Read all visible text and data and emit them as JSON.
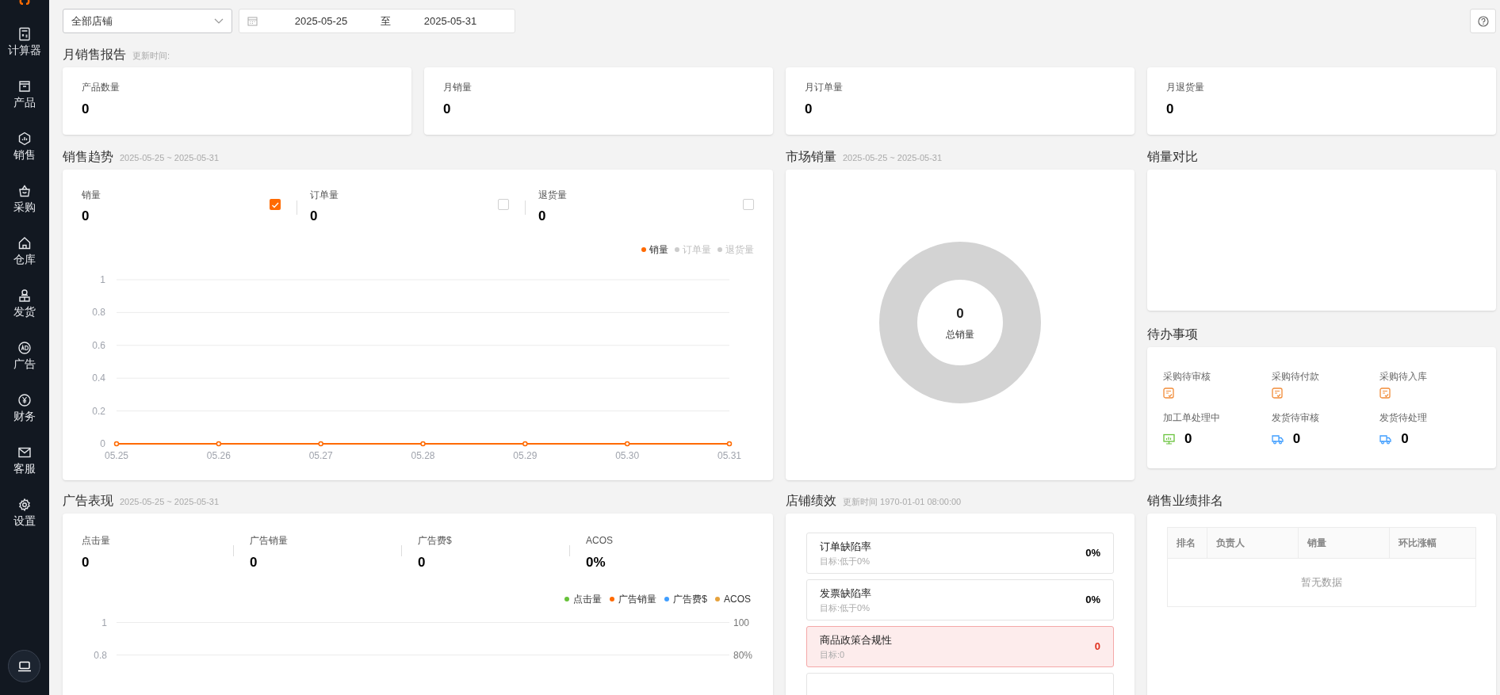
{
  "sidebar": {
    "items": [
      {
        "label": "计算器",
        "kind": "calculator"
      },
      {
        "label": "产品",
        "kind": "box"
      },
      {
        "label": "销售",
        "kind": "chart"
      },
      {
        "label": "采购",
        "kind": "basket"
      },
      {
        "label": "仓库",
        "kind": "home"
      },
      {
        "label": "发货",
        "kind": "courier"
      },
      {
        "label": "广告",
        "kind": "ad"
      },
      {
        "label": "财务",
        "kind": "yen"
      },
      {
        "label": "客服",
        "kind": "mail"
      },
      {
        "label": "设置",
        "kind": "gear"
      }
    ]
  },
  "toolbar": {
    "store_select": {
      "value": "全部店铺"
    },
    "date_range": {
      "start": "2025-05-25",
      "separator": "至",
      "end": "2025-05-31"
    }
  },
  "monthly_report": {
    "title": "月销售报告",
    "subtitle": "更新时间:",
    "cards": [
      {
        "label": "产品数量",
        "value": "0"
      },
      {
        "label": "月销量",
        "value": "0"
      },
      {
        "label": "月订单量",
        "value": "0"
      },
      {
        "label": "月退货量",
        "value": "0"
      }
    ]
  },
  "sales_trend": {
    "title": "销售趋势",
    "subtitle": "2025-05-25 ~ 2025-05-31",
    "metrics": [
      {
        "label": "销量",
        "value": "0",
        "checked": true
      },
      {
        "label": "订单量",
        "value": "0",
        "checked": false
      },
      {
        "label": "退货量",
        "value": "0",
        "checked": false
      }
    ],
    "legend": [
      {
        "label": "订单量",
        "active": false
      },
      {
        "label": "退货量",
        "active": false
      }
    ],
    "chart_data": {
      "type": "line",
      "categories": [
        "05.25",
        "05.26",
        "05.27",
        "05.28",
        "05.29",
        "05.30",
        "05.31"
      ],
      "series": [
        {
          "name": "销量",
          "color": "#ff6a00",
          "marker": true,
          "values": [
            0,
            0,
            0,
            0,
            0,
            0,
            0
          ]
        }
      ],
      "ylim": [
        0,
        1
      ],
      "yticks": [
        0,
        0.2,
        0.4,
        0.6,
        0.8,
        1
      ],
      "grid": true
    }
  },
  "market_sales": {
    "title": "市场销量",
    "subtitle": "2025-05-25 ~ 2025-05-31",
    "total": "0",
    "total_label": "总销量"
  },
  "sales_comparison": {
    "title": "销量对比"
  },
  "todo": {
    "title": "待办事项",
    "items": [
      {
        "label": "采购待审核",
        "kind": "doc"
      },
      {
        "label": "采购待付款",
        "kind": "doc"
      },
      {
        "label": "采购待入库",
        "kind": "doc"
      },
      {
        "label": "加工单处理中",
        "kind": "monitor",
        "count": "0"
      },
      {
        "label": "发货待审核",
        "kind": "truck",
        "count": "0"
      },
      {
        "label": "发货待处理",
        "kind": "truck",
        "count": "0"
      }
    ]
  },
  "ad_performance": {
    "title": "广告表现",
    "subtitle": "2025-05-25 ~ 2025-05-31",
    "metrics": [
      {
        "label": "点击量",
        "value": "0"
      },
      {
        "label": "广告销量",
        "value": "0"
      },
      {
        "label": "广告费$",
        "value": "0"
      },
      {
        "label": "ACOS",
        "value": "0%"
      }
    ],
    "legend": [
      {
        "label": "点击量",
        "color": "#67c23a"
      },
      {
        "label": "广告销量",
        "color": "#ff6a00"
      },
      {
        "label": "广告费$",
        "color": "#409eff"
      },
      {
        "label": "ACOS",
        "color": "#e6a23c"
      }
    ],
    "left_ticks": [
      "1",
      "0.8"
    ],
    "right_ticks": [
      "100",
      "80%"
    ]
  },
  "store_performance": {
    "title": "店铺绩效",
    "subtitle": "更新时间 1970-01-01 08:00:00",
    "items": [
      {
        "name": "订单缺陷率",
        "target": "目标:低于0%",
        "value": "0%",
        "alert": false
      },
      {
        "name": "发票缺陷率",
        "target": "目标:低于0%",
        "value": "0%",
        "alert": false
      },
      {
        "name": "商品政策合规性",
        "target": "目标:0",
        "value": "0",
        "alert": true
      }
    ]
  },
  "sales_ranking": {
    "title": "销售业绩排名",
    "table": {
      "columns": [
        "排名",
        "负责人",
        "销量",
        "环比涨幅"
      ],
      "empty_text": "暂无数据"
    }
  }
}
